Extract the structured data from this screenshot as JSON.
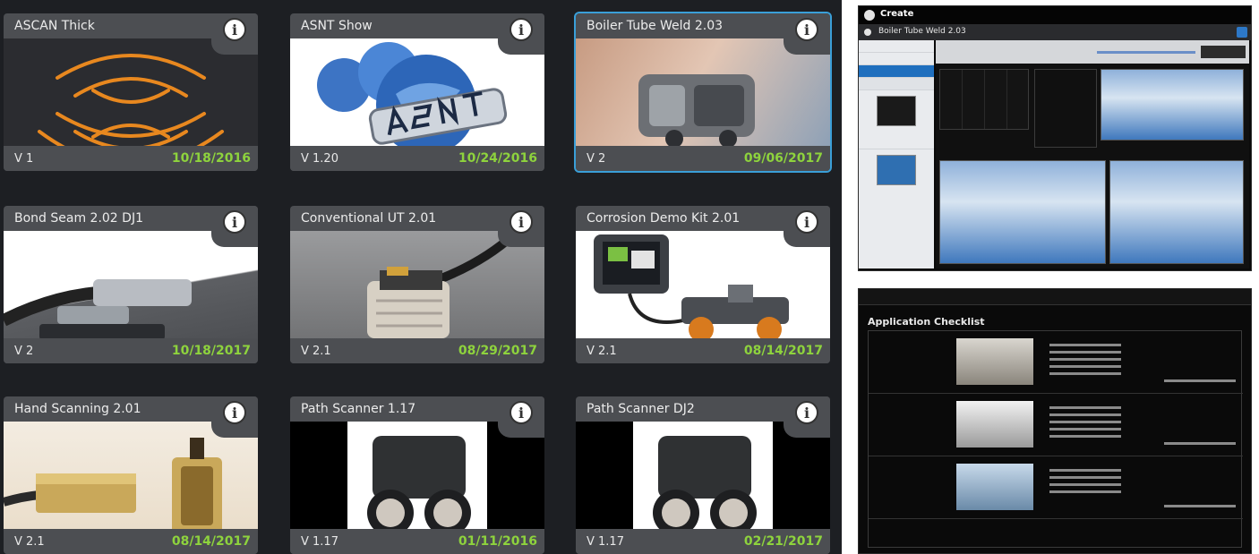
{
  "gallery": {
    "tiles": [
      {
        "title": "ASCAN Thick",
        "version": "V 1",
        "date": "10/18/2016",
        "selected": false,
        "thumbnail": "ascan-arcs"
      },
      {
        "title": "ASNT Show",
        "version": "V 1.20",
        "date": "10/24/2016",
        "selected": false,
        "thumbnail": "asnt-globe-logo"
      },
      {
        "title": "Boiler Tube Weld 2.03",
        "version": "V 2",
        "date": "09/06/2017",
        "selected": true,
        "thumbnail": "hand-held-scanner"
      },
      {
        "title": "Bond Seam 2.02 DJ1",
        "version": "V 2",
        "date": "10/18/2017",
        "selected": false,
        "thumbnail": "probe-on-plate"
      },
      {
        "title": "Conventional UT 2.01",
        "version": "V 2.1",
        "date": "08/29/2017",
        "selected": false,
        "thumbnail": "ut-probe-cable"
      },
      {
        "title": "Corrosion Demo Kit 2.01",
        "version": "V 2.1",
        "date": "08/14/2017",
        "selected": false,
        "thumbnail": "instrument-and-scanner"
      },
      {
        "title": "Hand Scanning 2.01",
        "version": "V 2.1",
        "date": "08/14/2017",
        "selected": false,
        "thumbnail": "brass-probes"
      },
      {
        "title": "Path Scanner 1.17",
        "version": "V 1.17",
        "date": "01/11/2016",
        "selected": false,
        "thumbnail": "wheeled-scanner"
      },
      {
        "title": "Path Scanner DJ2",
        "version": "V 1.17",
        "date": "02/21/2017",
        "selected": false,
        "thumbnail": "wheeled-scanner"
      }
    ],
    "info_icon": "info-icon",
    "colors": {
      "background": "#1d1f23",
      "tile": "#4c4e52",
      "date": "#8ed33d",
      "selected_outline": "#3a9fd8"
    }
  },
  "create_screen": {
    "app_name": "Create",
    "setup_title": "Boiler Tube Weld 2.03"
  },
  "checklist_screen": {
    "title": "Application Checklist"
  }
}
